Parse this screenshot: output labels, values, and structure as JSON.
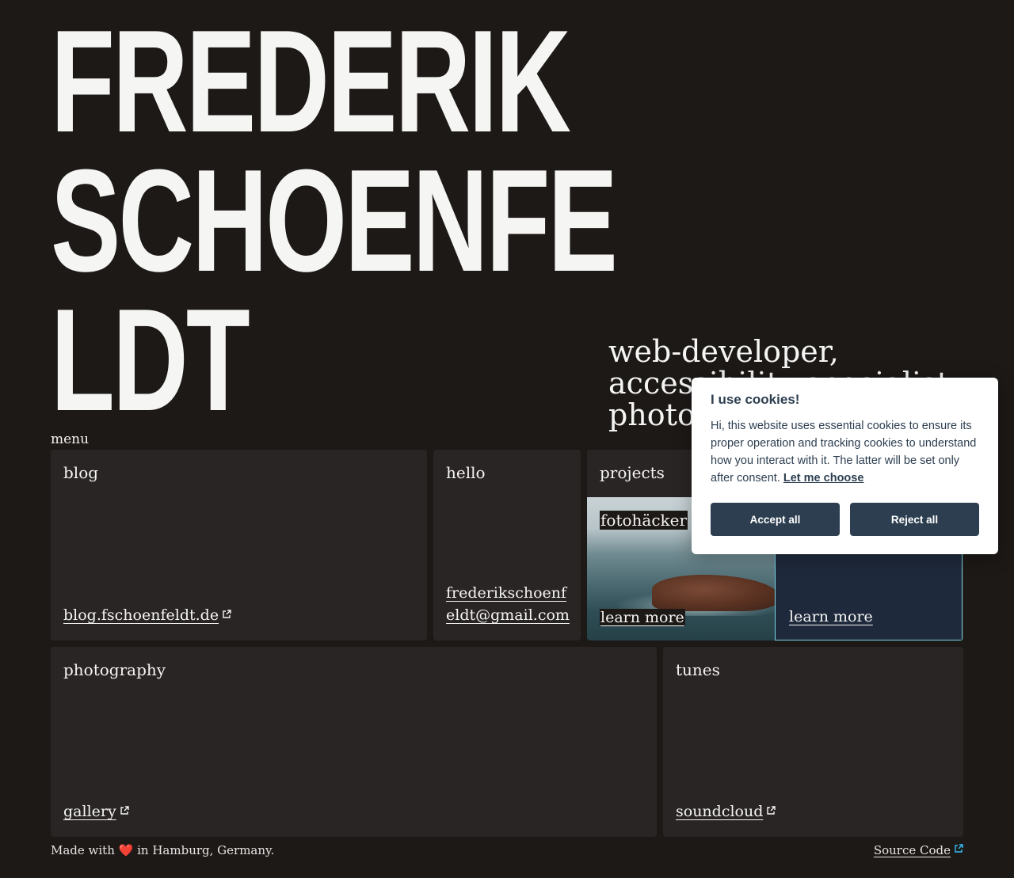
{
  "hero": {
    "line1": "FREDERIK",
    "line2": "SCHOENFE",
    "line3": "LDT"
  },
  "tagline": {
    "line1": "web-developer,",
    "line2": "accessibility specialist,",
    "line3": "photographer"
  },
  "menu_label": "menu",
  "cards": {
    "blog": {
      "title": "blog",
      "link": "blog.fschoenfeldt.de"
    },
    "hello": {
      "title": "hello",
      "link": "frederikschoenfeldt@gmail.com"
    },
    "projects": {
      "title": "projects",
      "tiles": [
        {
          "label": "fotohäcker",
          "link": "learn more"
        },
        {
          "link": "learn more"
        }
      ]
    },
    "photography": {
      "title": "photography",
      "link": "gallery"
    },
    "tunes": {
      "title": "tunes",
      "link": "soundcloud"
    }
  },
  "footer": {
    "made_with_prefix": "Made with",
    "heart": "❤️",
    "made_with_suffix": "in Hamburg, Germany.",
    "source_code": "Source Code"
  },
  "cookie": {
    "title": "I use cookies!",
    "text": "Hi, this website uses essential cookies to ensure its proper operation and tracking cookies to understand how you interact with it. The latter will be set only after consent.",
    "let_me_choose": "Let me choose",
    "accept": "Accept all",
    "reject": "Reject all"
  },
  "colors": {
    "background": "#1c1917",
    "card": "#292524",
    "text": "#f5f5f4",
    "cookie_button": "#2c3e50",
    "project_dark": "#1e293b"
  }
}
